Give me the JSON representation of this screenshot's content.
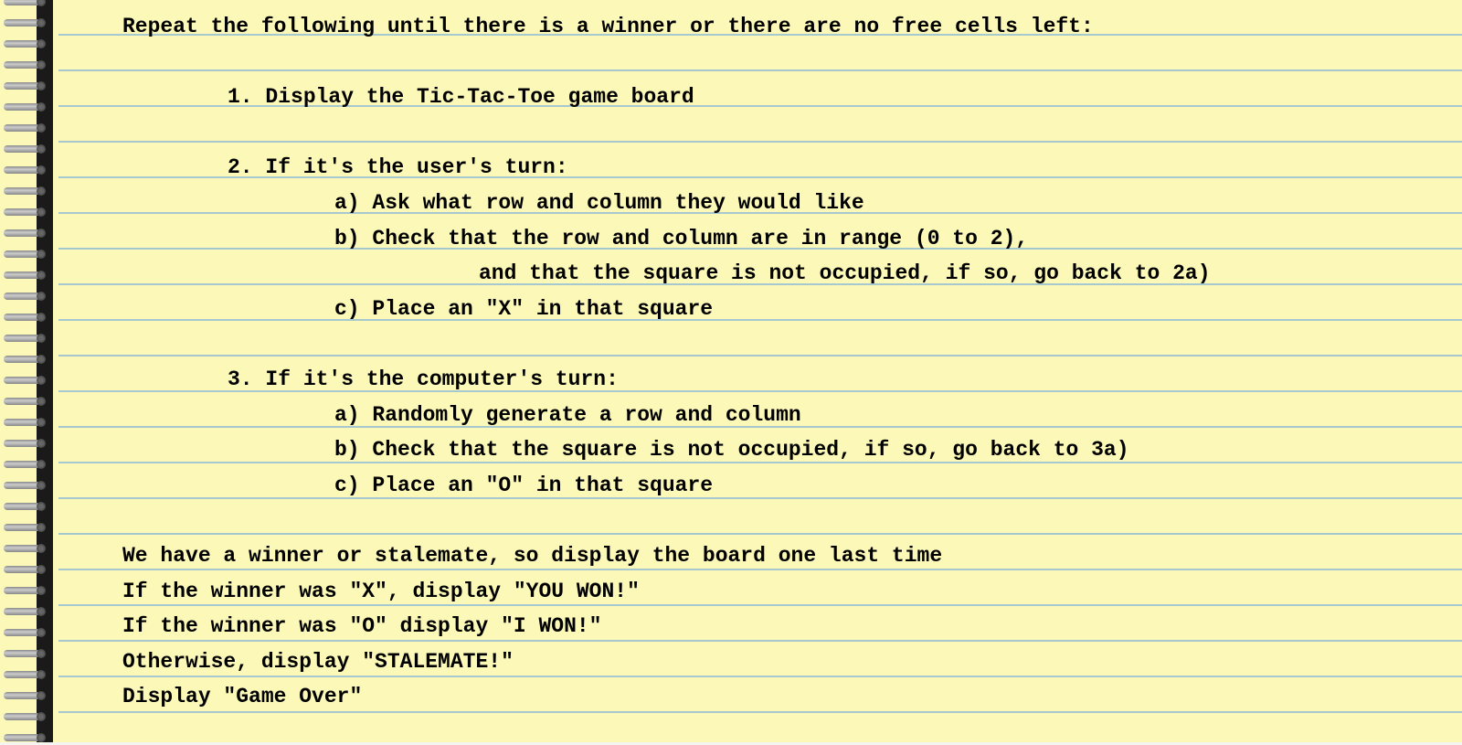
{
  "lines": [
    {
      "indent": 1,
      "text": "Repeat the following until there is a winner or there are no free cells left:"
    },
    {
      "indent": 1,
      "text": ""
    },
    {
      "indent": 2,
      "text": "1. Display the Tic-Tac-Toe game board"
    },
    {
      "indent": 1,
      "text": ""
    },
    {
      "indent": 2,
      "text": "2. If it's the user's turn:"
    },
    {
      "indent": 3,
      "text": "a) Ask what row and column they would like"
    },
    {
      "indent": 3,
      "text": "b) Check that the row and column are in range (0 to 2),"
    },
    {
      "indent": 4,
      "text": "and that the square is not occupied, if so, go back to 2a)"
    },
    {
      "indent": 3,
      "text": "c) Place an \"X\" in that square"
    },
    {
      "indent": 1,
      "text": ""
    },
    {
      "indent": 2,
      "text": "3. If it's the computer's turn:"
    },
    {
      "indent": 3,
      "text": "a) Randomly generate a row and column"
    },
    {
      "indent": 3,
      "text": "b) Check that the square is not occupied, if so, go back to 3a)"
    },
    {
      "indent": 3,
      "text": "c) Place an \"O\" in that square"
    },
    {
      "indent": 1,
      "text": ""
    },
    {
      "indent": 1,
      "text": "We have a winner or stalemate, so display the board one last time"
    },
    {
      "indent": 1,
      "text": "If the winner was \"X\", display \"YOU WON!\""
    },
    {
      "indent": 1,
      "text": "If the winner was \"O\" display \"I WON!\""
    },
    {
      "indent": 1,
      "text": "Otherwise, display \"STALEMATE!\""
    },
    {
      "indent": 1,
      "text": "Display \"Game Over\""
    }
  ]
}
